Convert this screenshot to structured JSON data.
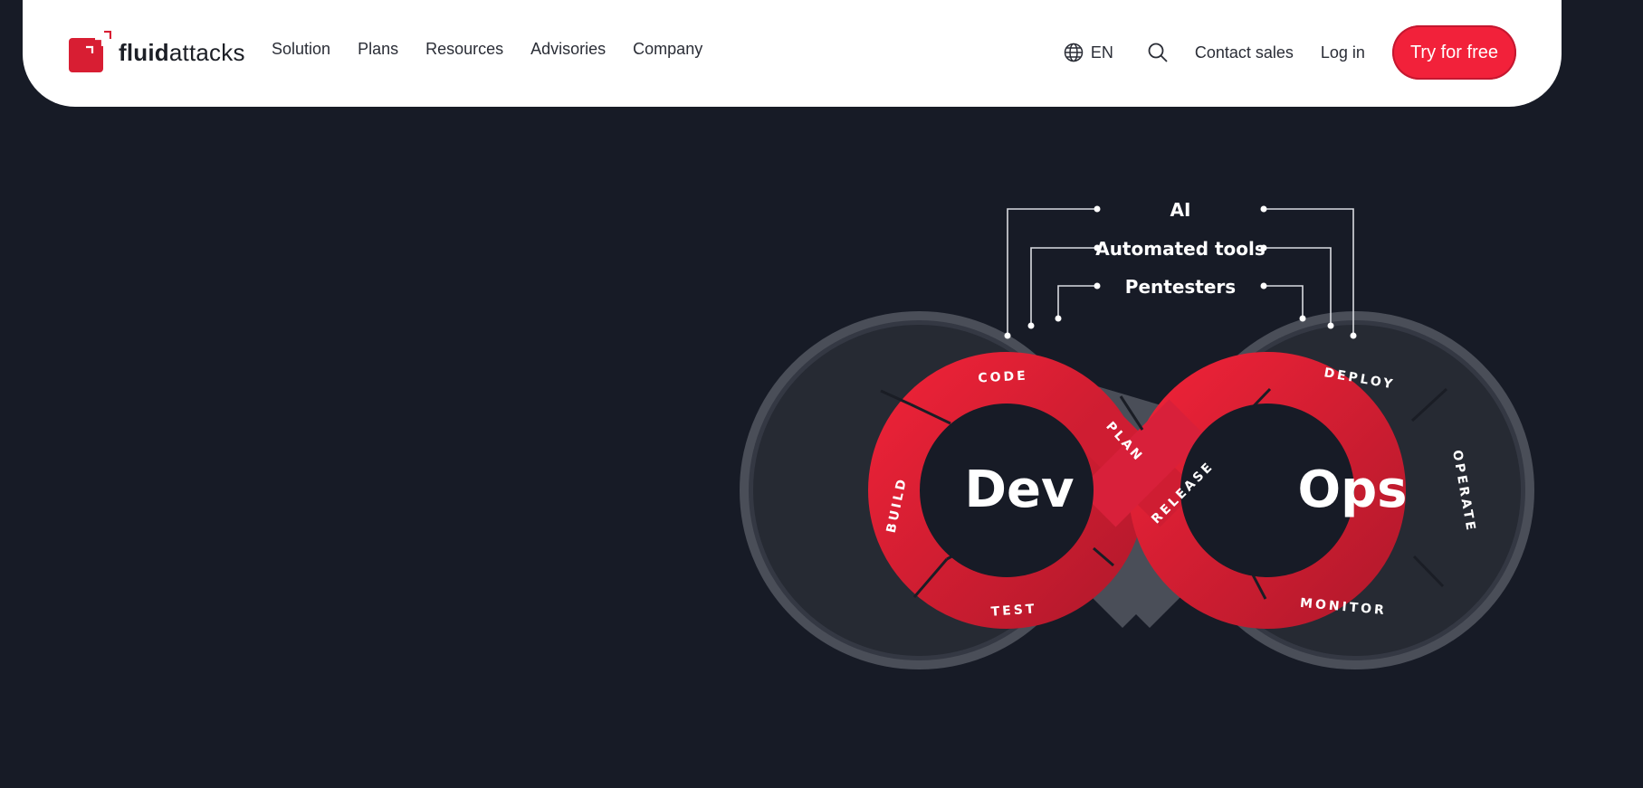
{
  "header": {
    "logo": {
      "bold": "fluid",
      "light": "attacks"
    },
    "nav": [
      {
        "label": "Solution"
      },
      {
        "label": "Plans"
      },
      {
        "label": "Resources"
      },
      {
        "label": "Advisories"
      },
      {
        "label": "Company"
      }
    ],
    "language": "EN",
    "contact_sales": "Contact sales",
    "login": "Log in",
    "cta": "Try for free"
  },
  "diagram": {
    "sources": [
      "AI",
      "Automated tools",
      "Pentesters"
    ],
    "dev_label": "Dev",
    "ops_label": "Ops",
    "stages": {
      "code": "CODE",
      "plan": "PLAN",
      "build": "BUILD",
      "test": "TEST",
      "release": "RELEASE",
      "deploy": "DEPLOY",
      "operate": "OPERATE",
      "monitor": "MONITOR"
    }
  },
  "colors": {
    "background": "#171b26",
    "brand_red": "#f2213a",
    "ring_red": "#d81f34"
  }
}
